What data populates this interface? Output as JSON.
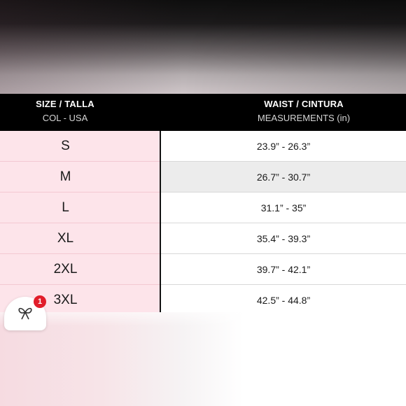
{
  "header": {
    "size_title": "SIZE / TALLA",
    "size_sub": "COL - USA",
    "waist_title": "WAIST / CINTURA",
    "waist_sub": "MEASUREMENTS (in)"
  },
  "rows": [
    {
      "size": "S",
      "waist": "23.9” - 26.3”"
    },
    {
      "size": "M",
      "waist": "26.7” - 30.7”"
    },
    {
      "size": "L",
      "waist": "31.1” - 35”"
    },
    {
      "size": "XL",
      "waist": "35.4” - 39.3”"
    },
    {
      "size": "2XL",
      "waist": "39.7” - 42.1”"
    },
    {
      "size": "3XL",
      "waist": "42.5” - 44.8”"
    }
  ],
  "chat_widget": {
    "icon": "gift-icon",
    "badge_count": "1",
    "badge_color": "#e11d2a"
  },
  "colors": {
    "header_bg": "#000000",
    "size_column_bg": "#fde4ea"
  }
}
